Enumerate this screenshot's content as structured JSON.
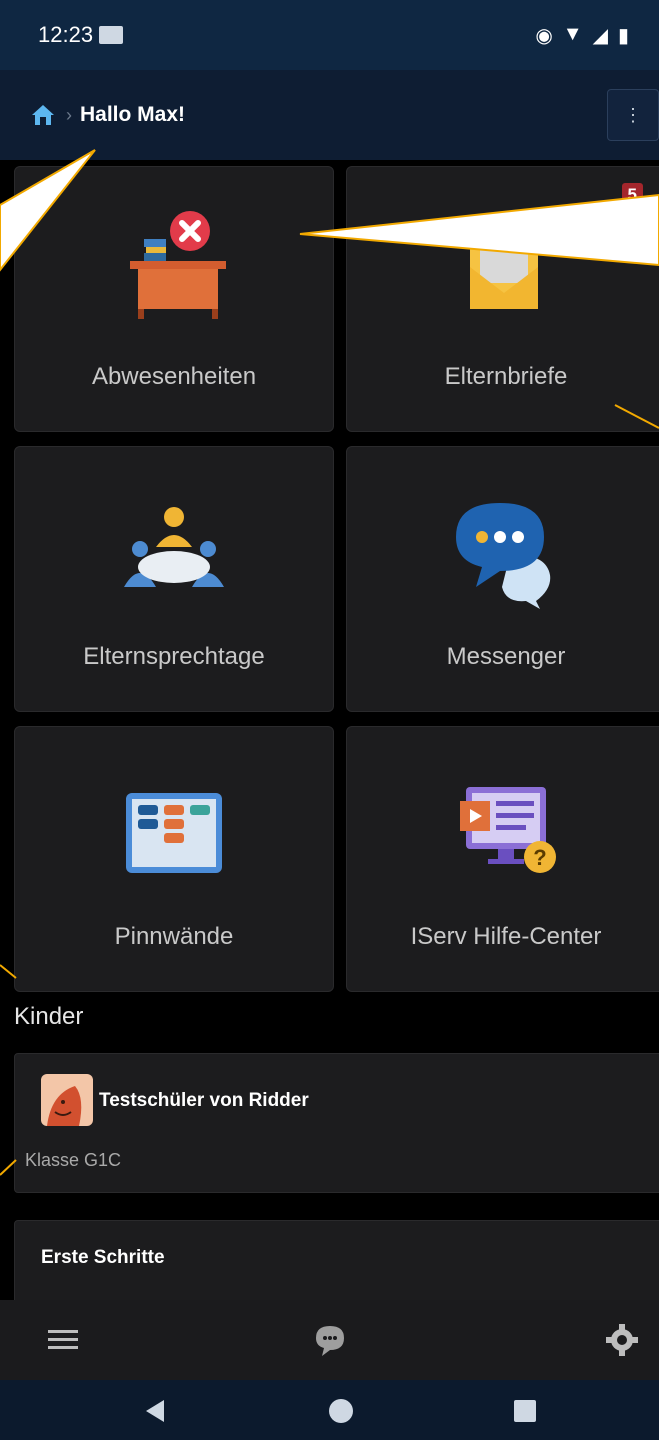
{
  "status_bar": {
    "time": "12:23",
    "icons": [
      "eye-icon",
      "wifi-icon",
      "signal-icon",
      "battery-icon"
    ]
  },
  "app_bar": {
    "greeting": "Hallo Max!",
    "menu_icon": "more-vertical-icon"
  },
  "tiles": [
    {
      "label": "Abwesenheiten",
      "icon": "desk-absence-icon"
    },
    {
      "label": "Elternbriefe",
      "icon": "envelope-letter-icon",
      "badge": "5"
    },
    {
      "label": "Elternsprechtage",
      "icon": "meeting-table-icon"
    },
    {
      "label": "Messenger",
      "icon": "chat-bubbles-icon"
    },
    {
      "label": "Pinnwände",
      "icon": "board-icon"
    },
    {
      "label": "IServ Hilfe-Center",
      "icon": "help-monitor-icon"
    }
  ],
  "children_section": {
    "title": "Kinder",
    "child": {
      "name": "Testschüler von Ridder",
      "class": "Klasse G1C"
    }
  },
  "first_steps": {
    "title": "Erste Schritte"
  },
  "bottom_bar": {
    "items": [
      "menu-icon",
      "chat-icon",
      "settings-icon"
    ]
  },
  "nav_bar": {
    "items": [
      "back-icon",
      "home-icon",
      "recents-icon"
    ]
  },
  "colors": {
    "app_bar": "#0e1d33",
    "status_bar": "#0f2742",
    "tile": "#1c1c1e",
    "badge": "#a4262c",
    "callout": "#f2a900"
  }
}
